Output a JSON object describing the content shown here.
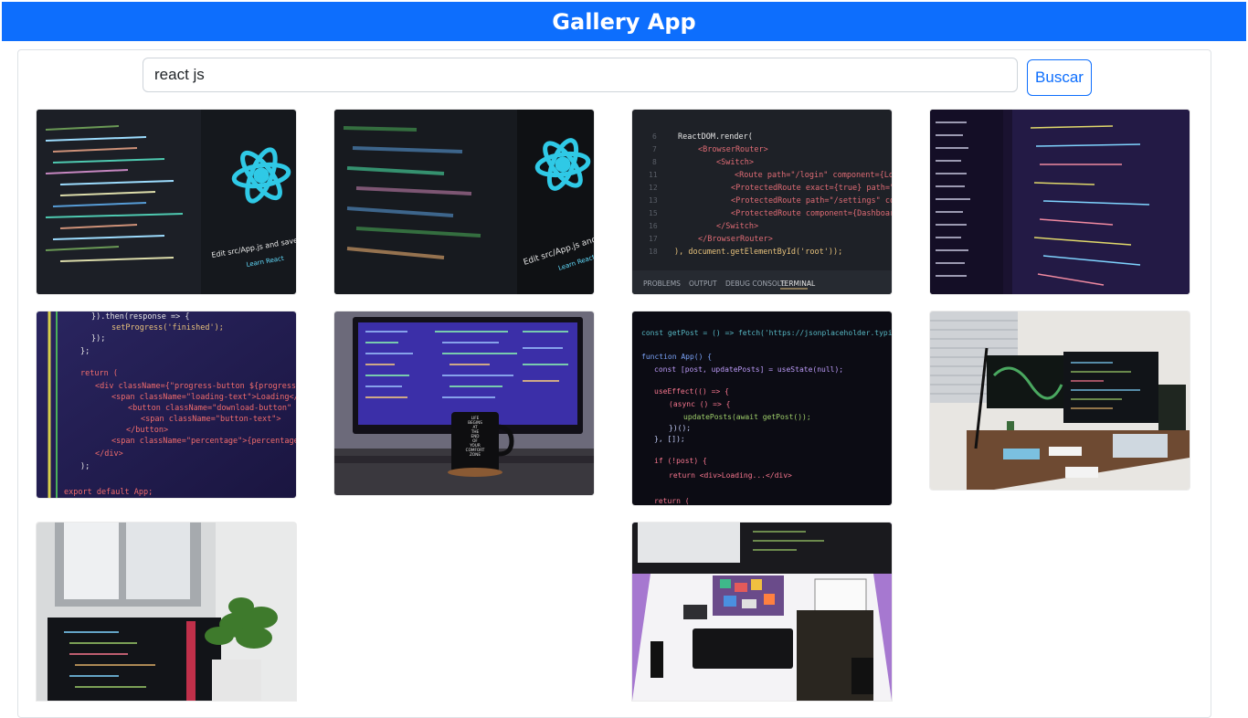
{
  "header": {
    "title": "Gallery App"
  },
  "search": {
    "value": "react js",
    "button_label": "Buscar"
  },
  "gallery": {
    "images": [
      {
        "subject": "react logo and code editor on monitor",
        "caption_lines": [
          "Edit src/App.js and save to rel",
          "Learn React"
        ]
      },
      {
        "subject": "blurred code editor with react logo",
        "caption_lines": [
          "Edit src/App.js and save to",
          "Learn React"
        ]
      },
      {
        "subject": "ReactDOM render code in editor",
        "code_lines": [
          "ReactDOM.render(",
          "<BrowserRouter>",
          "<Switch>",
          "<Route path=\"/login\" component={Login} />",
          "<ProtectedRoute exact={true} path=\"/\" component",
          "<ProtectedRoute path=\"/settings\" component={Se",
          "<ProtectedRoute component={Dashboard} />",
          "</Switch>",
          "</BrowserRouter>",
          "), document.getElementById('root'));"
        ],
        "tabs": [
          "PROBLEMS",
          "OUTPUT",
          "DEBUG CONSOLE",
          "TERMINAL"
        ]
      },
      {
        "subject": "purple lit code editor with file tree"
      },
      {
        "subject": "JSX code close-up",
        "code_lines": [
          "}).then(response => {",
          "setProgress('finished');",
          "});",
          "};",
          "return (",
          "<div className={\"progress-button ${progress}\"}>",
          "<span className=\"loading-text\">Loading</span>",
          "<button className=\"download-button\"",
          "<span className=\"button-text\">",
          "</button>",
          "<span className=\"percentage\">{percentage}</span>",
          "</div>",
          ");",
          "export default App;"
        ]
      },
      {
        "subject": "monitor with code and mug",
        "mug_text": [
          "LIFE",
          "BEGINS",
          "AT",
          "THE",
          "END",
          "OF",
          "YOUR",
          "COMFORT",
          "ZONE"
        ]
      },
      {
        "subject": "dark code editor with fetch",
        "code_lines": [
          "const getPost = () => fetch('https://jsonplaceholder.typicode",
          "function App() {",
          "const [post, updatePosts] = useState(null);",
          "useEffect(() => {",
          "(async () => {",
          "updatePosts(await getPost());",
          "})();",
          "}, []);",
          "if (!post) {",
          "return <div>Loading...</div>",
          "return ("
        ]
      },
      {
        "subject": "desk setup with two monitors and laptop"
      },
      {
        "subject": "laptop near window with plant"
      },
      {
        "subject": "top view desk with keyboard and monitor"
      }
    ]
  },
  "colors": {
    "accent": "#0d6efd",
    "react": "#2fc9e6",
    "editor_bg": "#1b1d23"
  }
}
